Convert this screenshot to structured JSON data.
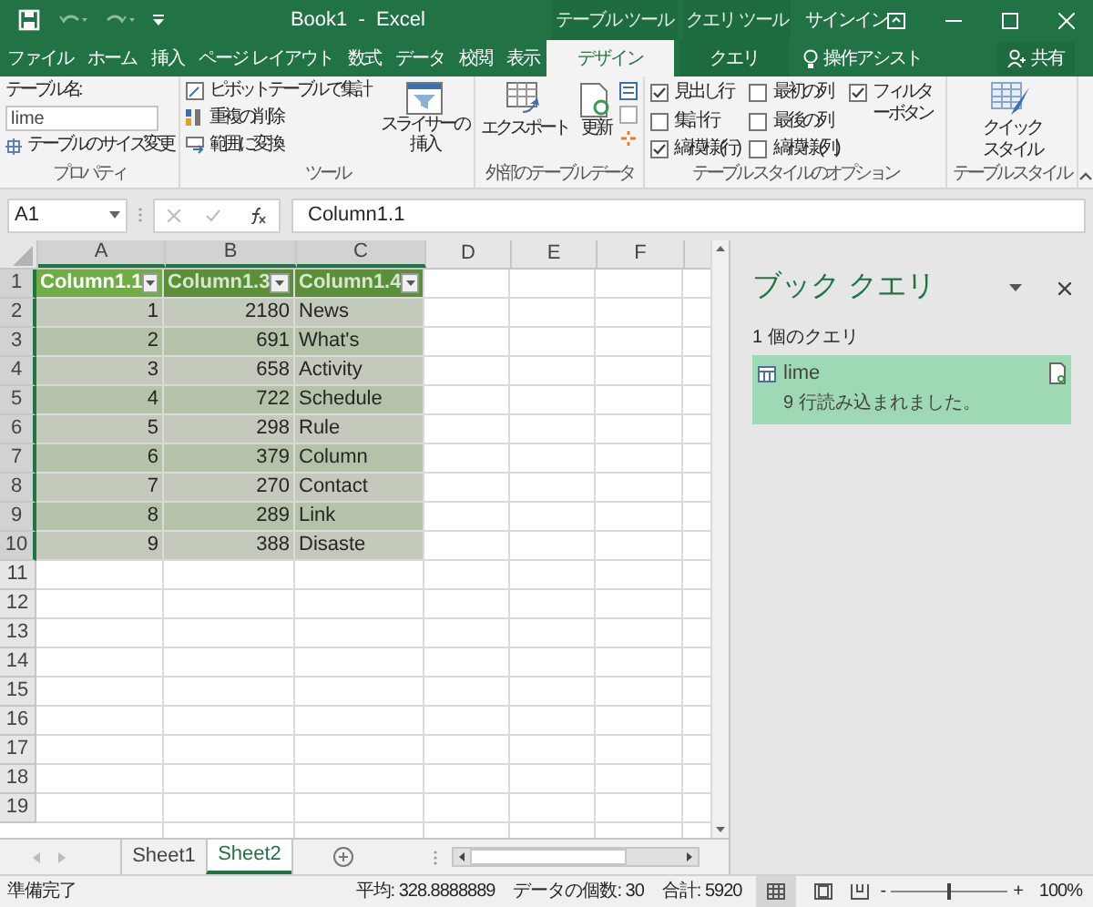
{
  "window": {
    "title": "Book1  -  Excel"
  },
  "context_tabs": [
    {
      "label": "テーブル ツール"
    },
    {
      "label": "クエリ ツール"
    }
  ],
  "account": "サインイン",
  "ribbon_tabs": [
    {
      "label": "ファイル",
      "selected": false
    },
    {
      "label": "ホーム",
      "selected": false
    },
    {
      "label": "挿入",
      "selected": false
    },
    {
      "label": "ページ レイアウト",
      "selected": false
    },
    {
      "label": "数式",
      "selected": false
    },
    {
      "label": "データ",
      "selected": false
    },
    {
      "label": "校閲",
      "selected": false
    },
    {
      "label": "表示",
      "selected": false
    },
    {
      "label": "デザイン",
      "selected": true
    },
    {
      "label": "クエリ",
      "selected": false
    }
  ],
  "tell_me": "操作アシスト",
  "share": "共有",
  "ribbon": {
    "properties": {
      "name_label": "テーブル名:",
      "name_value": "lime",
      "resize": "テーブルのサイズ変更",
      "label": "プロパティ"
    },
    "tools": {
      "items": [
        "ピボットテーブルで集計",
        "重複の削除",
        "範囲に変換"
      ],
      "slicer": [
        "スライサーの",
        "挿入"
      ],
      "label": "ツール"
    },
    "external": {
      "export": "エクスポート",
      "refresh": "更新",
      "label": "外部のテーブル データ"
    },
    "style_options": {
      "options": [
        {
          "label": "見出し行",
          "checked": true
        },
        {
          "label": "集計行",
          "checked": false
        },
        {
          "label": "縞模様 (行)",
          "checked": true
        },
        {
          "label": "最初の列",
          "checked": false
        },
        {
          "label": "最後の列",
          "checked": false
        },
        {
          "label": "縞模様 (列)",
          "checked": false
        },
        {
          "label": "フィルター ボタン",
          "checked": true
        }
      ],
      "label": "テーブル スタイルのオプション"
    },
    "styles": {
      "quick": [
        "クイック",
        "スタイル"
      ],
      "label": "テーブル スタイル"
    }
  },
  "formula_bar": {
    "name_box": "A1",
    "formula": "Column1.1"
  },
  "sheet": {
    "columns": [
      {
        "label": "A",
        "selected": true
      },
      {
        "label": "B",
        "selected": true
      },
      {
        "label": "C",
        "selected": true
      },
      {
        "label": "D",
        "selected": false
      },
      {
        "label": "E",
        "selected": false
      },
      {
        "label": "F",
        "selected": false
      }
    ],
    "rows": [
      {
        "label": "1",
        "selected": true
      },
      {
        "label": "2",
        "selected": true
      },
      {
        "label": "3",
        "selected": true
      },
      {
        "label": "4",
        "selected": true
      },
      {
        "label": "5",
        "selected": true
      },
      {
        "label": "6",
        "selected": true
      },
      {
        "label": "7",
        "selected": true
      },
      {
        "label": "8",
        "selected": true
      },
      {
        "label": "9",
        "selected": true
      },
      {
        "label": "10",
        "selected": true
      },
      {
        "label": "11",
        "selected": false
      },
      {
        "label": "12",
        "selected": false
      },
      {
        "label": "13",
        "selected": false
      },
      {
        "label": "14",
        "selected": false
      },
      {
        "label": "15",
        "selected": false
      },
      {
        "label": "16",
        "selected": false
      },
      {
        "label": "17",
        "selected": false
      },
      {
        "label": "18",
        "selected": false
      },
      {
        "label": "19",
        "selected": false
      }
    ],
    "table": {
      "columns": [
        {
          "header": "Column1.1",
          "kind": "number"
        },
        {
          "header": "Column1.3",
          "kind": "number"
        },
        {
          "header": "Column1.4",
          "kind": "text"
        }
      ],
      "rows": [
        [
          "1",
          "2180",
          "News"
        ],
        [
          "2",
          "691",
          "What's"
        ],
        [
          "3",
          "658",
          "Activity"
        ],
        [
          "4",
          "722",
          "Schedule"
        ],
        [
          "5",
          "298",
          "Rule"
        ],
        [
          "6",
          "379",
          "Column"
        ],
        [
          "7",
          "270",
          "Contact"
        ],
        [
          "8",
          "289",
          "Link"
        ],
        [
          "9",
          "388",
          "Disaste"
        ]
      ]
    }
  },
  "query_pane": {
    "title": "ブック クエリ",
    "count": "1 個のクエリ",
    "queries": [
      {
        "name": "lime",
        "status": "9 行読み込まれました。"
      }
    ]
  },
  "sheet_tabs": [
    {
      "label": "Sheet1",
      "selected": false
    },
    {
      "label": "Sheet2",
      "selected": true
    }
  ],
  "status_bar": {
    "ready": "準備完了",
    "average": "平均: 328.8888889",
    "count": "データの個数: 30",
    "sum": "合計: 5920",
    "zoom": {
      "minus": "-",
      "plus": "+",
      "value": "100%",
      "level": 0.5
    }
  }
}
